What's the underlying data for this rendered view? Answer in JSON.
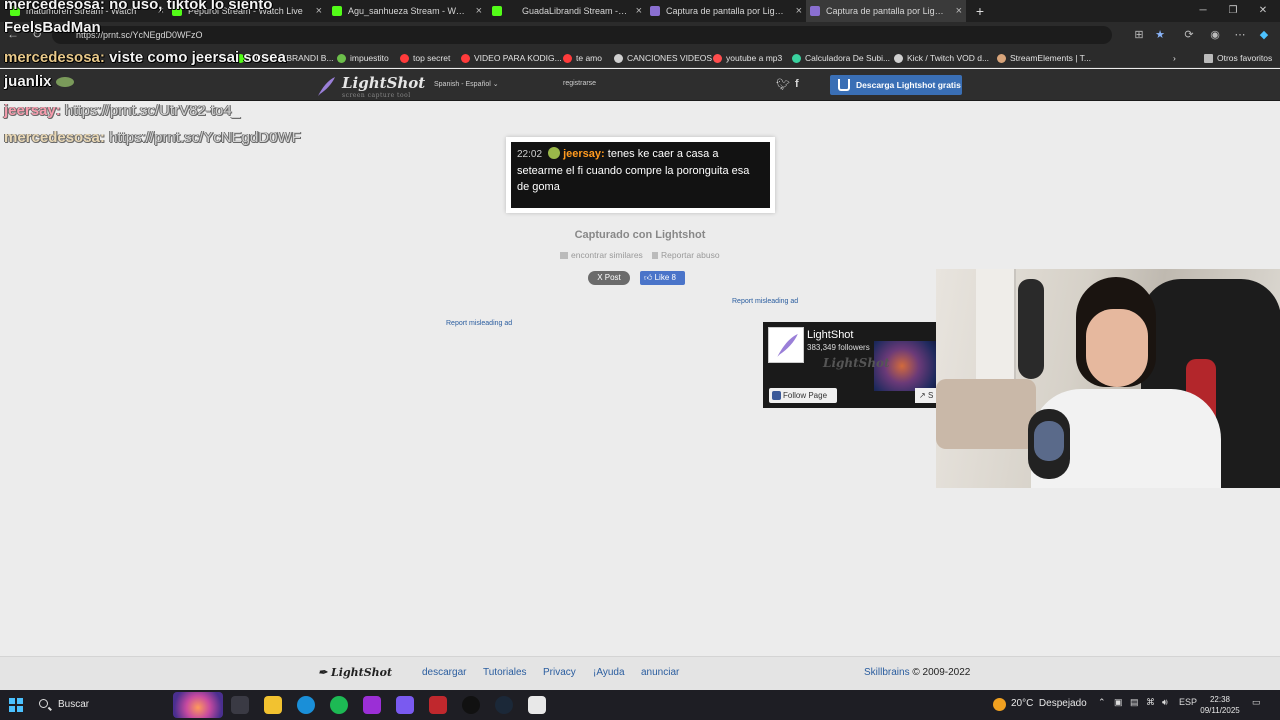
{
  "browser": {
    "tabs": [
      {
        "title": "matumoren Stream - Watch",
        "favicon_color": "#53fc18"
      },
      {
        "title": "Pepuroi Stream - Watch Live",
        "favicon_color": "#53fc18"
      },
      {
        "title": "Agu_sanhueza Stream - Watch Live",
        "favicon_color": "#53fc18"
      },
      {
        "title": "GuadaLibrandi Stream - Watch",
        "favicon_color": "#53fc18"
      },
      {
        "title": "Captura de pantalla por Lightshot",
        "favicon_color": "#8a6fd1"
      },
      {
        "title": "Captura de pantalla por Lightshot",
        "favicon_color": "#8a6fd1"
      }
    ],
    "active_tab_index": 5,
    "url": "https://prnt.sc/YcNEgdD0WFzO",
    "bookmarks": [
      {
        "label": "GUADALIBRANDI B...",
        "color": "#53fc18"
      },
      {
        "label": "impuestito",
        "color": "#6cbf4a"
      },
      {
        "label": "top secret",
        "color": "#ff3b3b"
      },
      {
        "label": "VIDEO PARA KODIG...",
        "color": "#ff3b3b"
      },
      {
        "label": "te amo",
        "color": "#ff3b3b"
      },
      {
        "label": "CANCIONES VIDEOS",
        "color": "#cfcfcf"
      },
      {
        "label": "youtube a mp3",
        "color": "#ff4d4d"
      },
      {
        "label": "Calculadora De Subi...",
        "color": "#3ad29f"
      },
      {
        "label": "Kick / Twitch VOD d...",
        "color": "#cfcfcf"
      },
      {
        "label": "StreamElements | T...",
        "color": "#d8a47a"
      }
    ],
    "other_favorites": "Otros favoritos"
  },
  "lightshot": {
    "logo": "LightShot",
    "logo_tagline": "screen capture tool",
    "language": "Spanish - Español",
    "register": "registrarse",
    "download_button": "Descarga Lightshot gratis",
    "screenshot_chat": {
      "time": "22:02",
      "user": "jeersay",
      "message": "tenes ke caer a casa a setearme el fi cuando compre la poronguita esa de goma"
    },
    "captured_with": "Capturado con Lightshot",
    "find_similar": "encontrar similares",
    "report_abuse": "Reportar abuso",
    "x_post": "X Post",
    "fb_like": "Like 8",
    "report_ad": "Report misleading ad",
    "fb_page": {
      "name": "LightShot",
      "followers": "383,349 followers",
      "follow_button": "Follow Page",
      "share": "S"
    },
    "footer": {
      "logo": "LightShot",
      "links": [
        "descargar",
        "Tutoriales",
        "Privacy",
        "¡Ayuda",
        "anunciar"
      ],
      "company": "Skillbrains",
      "copyright": "© 2009-2022"
    }
  },
  "stream_overlay": {
    "lines": [
      {
        "user": "mercedesosa:",
        "text": " no uso, tiktok lo siento"
      },
      {
        "user": "",
        "text": "FeelsBadMan"
      },
      {
        "user": "mercedesosa:",
        "text": " viste como jeersai sosea"
      },
      {
        "user": "juanlix",
        "text": ""
      },
      {
        "user": "jeersay:",
        "text": " https://prnt.sc/UtrV82-to4_"
      },
      {
        "user": "mercedesosa:",
        "text": " https://prnt.sc/YcNEgdD0WF"
      }
    ]
  },
  "taskbar": {
    "search_placeholder": "Buscar",
    "weather_temp": "20°C",
    "weather_desc": "Despejado",
    "language": "ESP",
    "time": "22:38",
    "date": "09/11/2025"
  }
}
